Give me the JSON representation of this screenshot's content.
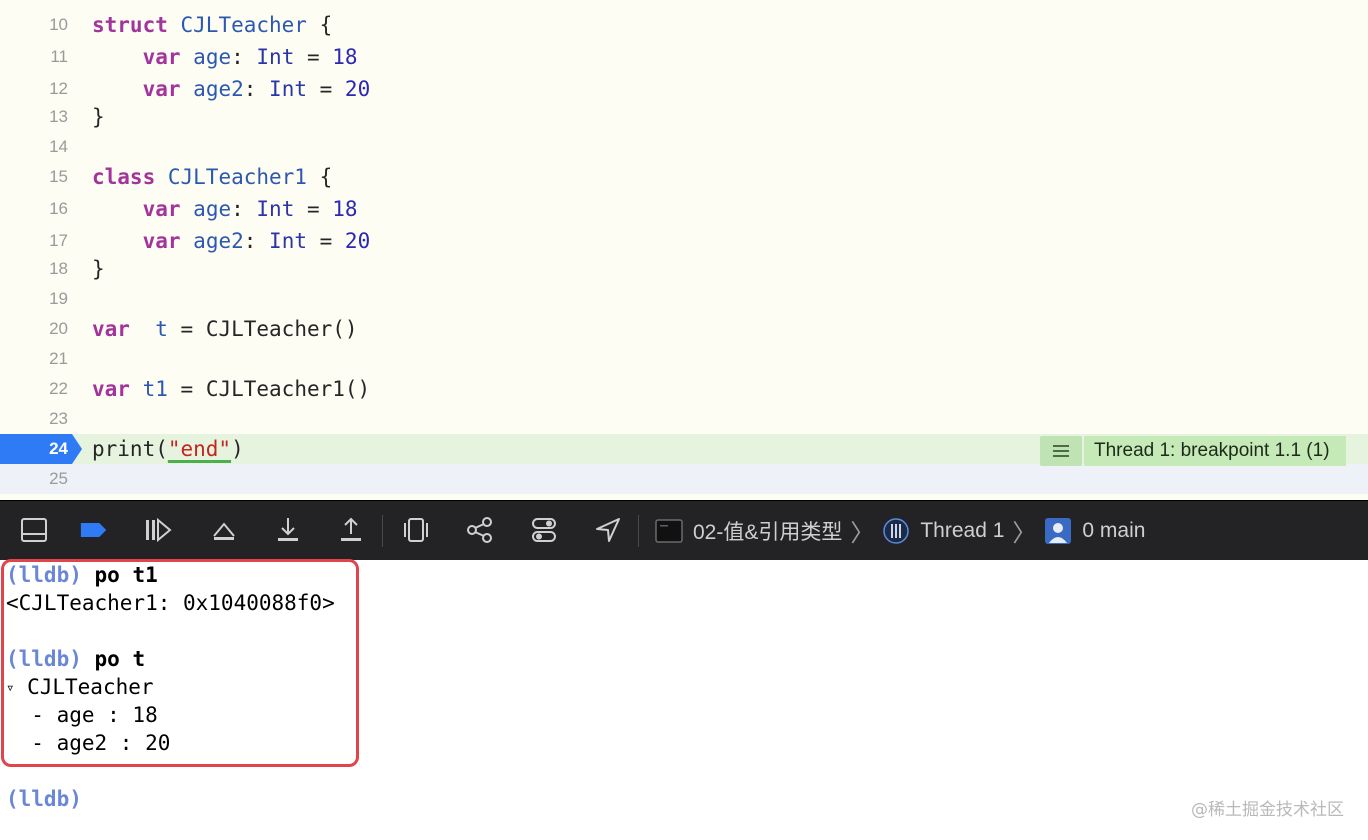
{
  "editor": {
    "lines": [
      {
        "num": "10",
        "tokens": [
          {
            "t": "struct",
            "c": "kw"
          },
          {
            "t": " ",
            "c": "plain"
          },
          {
            "t": "CJLTeacher",
            "c": "ty"
          },
          {
            "t": " {",
            "c": "plain"
          }
        ]
      },
      {
        "num": "11",
        "tokens": [
          {
            "t": "    ",
            "c": "plain"
          },
          {
            "t": "var",
            "c": "kw"
          },
          {
            "t": " ",
            "c": "plain"
          },
          {
            "t": "age",
            "c": "ty"
          },
          {
            "t": ": ",
            "c": "plain"
          },
          {
            "t": "Int",
            "c": "tyn"
          },
          {
            "t": " = ",
            "c": "plain"
          },
          {
            "t": "18",
            "c": "num"
          }
        ]
      },
      {
        "num": "12",
        "tokens": [
          {
            "t": "    ",
            "c": "plain"
          },
          {
            "t": "var",
            "c": "kw"
          },
          {
            "t": " ",
            "c": "plain"
          },
          {
            "t": "age2",
            "c": "ty"
          },
          {
            "t": ": ",
            "c": "plain"
          },
          {
            "t": "Int",
            "c": "tyn"
          },
          {
            "t": " = ",
            "c": "plain"
          },
          {
            "t": "20",
            "c": "num"
          }
        ]
      },
      {
        "num": "13",
        "tokens": [
          {
            "t": "}",
            "c": "plain"
          }
        ]
      },
      {
        "num": "14",
        "tokens": []
      },
      {
        "num": "15",
        "tokens": [
          {
            "t": "class",
            "c": "kw"
          },
          {
            "t": " ",
            "c": "plain"
          },
          {
            "t": "CJLTeacher1",
            "c": "ty"
          },
          {
            "t": " {",
            "c": "plain"
          }
        ]
      },
      {
        "num": "16",
        "tokens": [
          {
            "t": "    ",
            "c": "plain"
          },
          {
            "t": "var",
            "c": "kw"
          },
          {
            "t": " ",
            "c": "plain"
          },
          {
            "t": "age",
            "c": "ty"
          },
          {
            "t": ": ",
            "c": "plain"
          },
          {
            "t": "Int",
            "c": "tyn"
          },
          {
            "t": " = ",
            "c": "plain"
          },
          {
            "t": "18",
            "c": "num"
          }
        ]
      },
      {
        "num": "17",
        "tokens": [
          {
            "t": "    ",
            "c": "plain"
          },
          {
            "t": "var",
            "c": "kw"
          },
          {
            "t": " ",
            "c": "plain"
          },
          {
            "t": "age2",
            "c": "ty"
          },
          {
            "t": ": ",
            "c": "plain"
          },
          {
            "t": "Int",
            "c": "tyn"
          },
          {
            "t": " = ",
            "c": "plain"
          },
          {
            "t": "20",
            "c": "num"
          }
        ]
      },
      {
        "num": "18",
        "tokens": [
          {
            "t": "}",
            "c": "plain"
          }
        ]
      },
      {
        "num": "19",
        "tokens": []
      },
      {
        "num": "20",
        "tokens": [
          {
            "t": "var",
            "c": "kw"
          },
          {
            "t": "  ",
            "c": "plain"
          },
          {
            "t": "t",
            "c": "ty"
          },
          {
            "t": " = CJLTeacher()",
            "c": "plain"
          }
        ]
      },
      {
        "num": "21",
        "tokens": []
      },
      {
        "num": "22",
        "tokens": [
          {
            "t": "var",
            "c": "kw"
          },
          {
            "t": " ",
            "c": "plain"
          },
          {
            "t": "t1",
            "c": "ty"
          },
          {
            "t": " = CJLTeacher1()",
            "c": "plain"
          }
        ]
      },
      {
        "num": "23",
        "tokens": []
      },
      {
        "num": "24",
        "tokens": [
          {
            "t": "print(",
            "c": "plain"
          },
          {
            "t": "\"end\"",
            "c": "str"
          },
          {
            "t": ")",
            "c": "plain"
          }
        ]
      },
      {
        "num": "25",
        "tokens": []
      }
    ],
    "current_line": "24",
    "badge_text": "Thread 1: breakpoint 1.1 (1)"
  },
  "toolbar": {
    "icons": [
      "hide-console-icon",
      "breakpoint-toggle-icon",
      "continue-icon",
      "step-over-icon",
      "step-into-icon",
      "step-out-icon",
      "view-hierarchy-icon",
      "memory-graph-icon",
      "environment-overrides-icon",
      "simulate-location-icon"
    ],
    "crumbs": {
      "target": "02-值&引用类型",
      "thread": "Thread 1",
      "frame": "0 main"
    }
  },
  "console": {
    "prompt": "(lldb)",
    "cmd1": "po t1",
    "out1": "<CJLTeacher1: 0x1040088f0>",
    "cmd2": "po t",
    "out2_head": "CJLTeacher",
    "disclosure": "▿",
    "out2_rows": [
      "  - age : 18",
      "  - age2 : 20"
    ]
  },
  "colors": {
    "editor_bg": "#fdfdf4",
    "keyword": "#a3349b",
    "breakpoint_blue": "#2f7bf5",
    "highlight_red": "#e0454c"
  },
  "watermark": "@稀土掘金技术社区"
}
